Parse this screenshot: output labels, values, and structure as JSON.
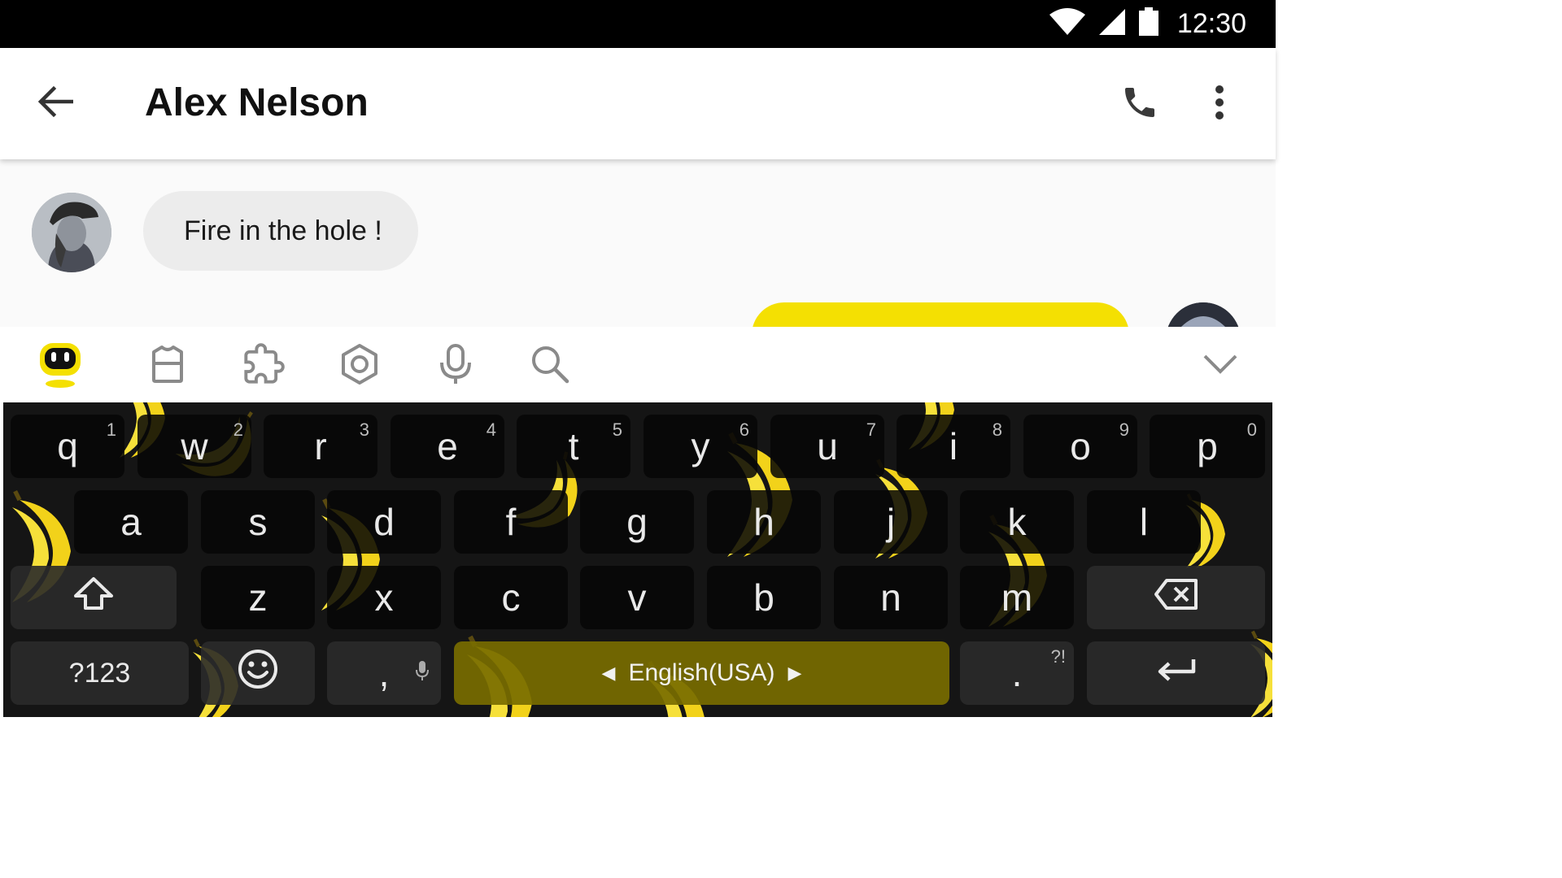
{
  "status_bar": {
    "time": "12:30",
    "icons": [
      "wifi-icon",
      "cellular-signal-icon",
      "battery-icon"
    ]
  },
  "app_bar": {
    "title": "Alex Nelson",
    "icons": [
      "back-arrow-icon",
      "phone-icon",
      "more-vert-icon"
    ]
  },
  "conversation": {
    "messages": [
      {
        "direction": "incoming",
        "text": "Fire in the hole !"
      },
      {
        "direction": "outgoing",
        "text": ""
      }
    ]
  },
  "keyboard_toolbar": {
    "items": [
      "assistant-robot-icon",
      "theme-shirt-icon",
      "extensions-puzzle-icon",
      "settings-hexagon-icon",
      "microphone-icon",
      "search-icon",
      "collapse-chevron-icon"
    ]
  },
  "keyboard": {
    "row1": [
      {
        "label": "q",
        "hint": "1"
      },
      {
        "label": "w",
        "hint": "2"
      },
      {
        "label": "r",
        "hint": "3"
      },
      {
        "label": "e",
        "hint": "4"
      },
      {
        "label": "t",
        "hint": "5"
      },
      {
        "label": "y",
        "hint": "6"
      },
      {
        "label": "u",
        "hint": "7"
      },
      {
        "label": "i",
        "hint": "8"
      },
      {
        "label": "o",
        "hint": "9"
      },
      {
        "label": "p",
        "hint": "0"
      }
    ],
    "row2": [
      "a",
      "s",
      "d",
      "f",
      "g",
      "h",
      "j",
      "k",
      "l"
    ],
    "row3": [
      "z",
      "x",
      "c",
      "v",
      "b",
      "n",
      "m"
    ],
    "symbols_label": "?123",
    "comma_label": ",",
    "space_label": "English(USA)",
    "period_label": ".",
    "period_hint": "?!",
    "theme_accent": "#f4e002",
    "keyboard_bg": "#151515"
  }
}
